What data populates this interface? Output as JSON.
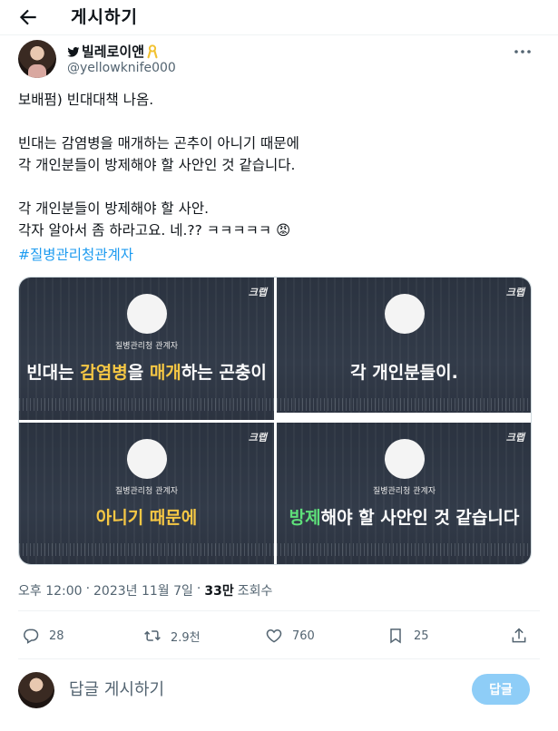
{
  "header": {
    "title": "게시하기"
  },
  "author": {
    "display_name": "빌레로이앤",
    "handle": "@yellowknife000"
  },
  "tweet": {
    "text": "보배펌) 빈대대책 나옴.\n\n빈대는 감염병을 매개하는 곤추이 아니기 때문에\n각 개인분들이 방제해야 할 사안인 것 같습니다.\n\n각 개인분들이 방제해야 할 사안.\n각자 알아서 좀 하라고요. 네.?? ㅋㅋㅋㅋㅋ 😡",
    "hashtag": "#질병관리청관계자"
  },
  "media": {
    "watermark": "크랩",
    "panels": [
      {
        "label": "질병관리청 관계자",
        "caption_parts": [
          {
            "text": "빈대는 ",
            "style": "plain"
          },
          {
            "text": "감염병",
            "style": "yellow"
          },
          {
            "text": "을 ",
            "style": "plain"
          },
          {
            "text": "매개",
            "style": "yellow"
          },
          {
            "text": "하는 곤충이",
            "style": "plain"
          }
        ]
      },
      {
        "label": "",
        "caption_parts": [
          {
            "text": "각 개인분들이.",
            "style": "plain"
          }
        ]
      },
      {
        "label": "질병관리청 관계자",
        "caption_parts": [
          {
            "text": "아니기 때문에",
            "style": "yellow"
          }
        ]
      },
      {
        "label": "질병관리청 관계자",
        "caption_parts": [
          {
            "text": "방제",
            "style": "green"
          },
          {
            "text": "해야 할 사안인 것 같습니다",
            "style": "plain"
          }
        ]
      }
    ],
    "colors": {
      "yellow": "#f6c744",
      "green": "#5ee07a"
    }
  },
  "meta": {
    "time": "오후 12:00",
    "separator": "·",
    "date": "2023년 11월 7일",
    "views_count": "33만",
    "views_label": "조회수"
  },
  "actions": {
    "reply_count": "28",
    "retweet_count": "2.9천",
    "like_count": "760",
    "bookmark_count": "25"
  },
  "reply": {
    "placeholder": "답글 게시하기",
    "button_label": "답글"
  },
  "colors": {
    "accent": "#1d9bf0",
    "muted": "#536471",
    "button_disabled": "#8ecdf7",
    "ribbon": "#f2c231"
  }
}
